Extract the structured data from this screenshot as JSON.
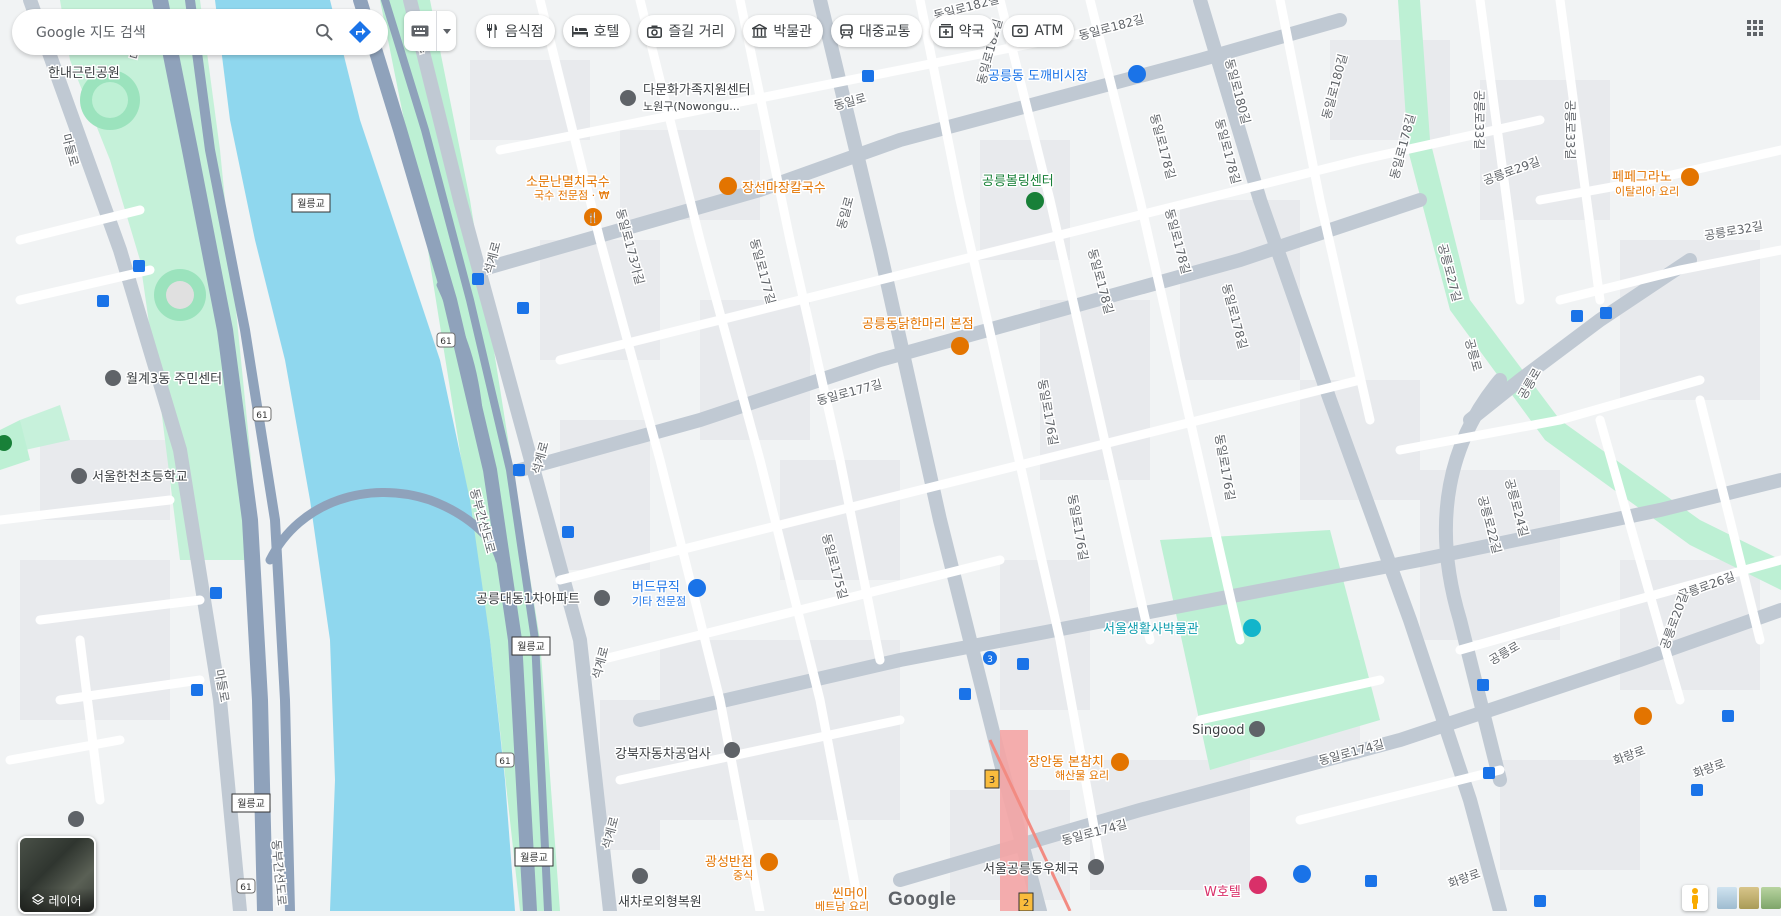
{
  "search": {
    "placeholder": "Google 지도 검색"
  },
  "chips": [
    {
      "label": "음식점",
      "icon": "fork-knife-icon"
    },
    {
      "label": "호텔",
      "icon": "bed-icon"
    },
    {
      "label": "즐길 거리",
      "icon": "camera-icon"
    },
    {
      "label": "박물관",
      "icon": "museum-icon"
    },
    {
      "label": "대중교통",
      "icon": "transit-icon"
    },
    {
      "label": "약국",
      "icon": "pharmacy-icon"
    },
    {
      "label": "ATM",
      "icon": "atm-icon"
    }
  ],
  "layers": {
    "label": "레이어"
  },
  "colors": {
    "water": "#8fd7ee",
    "park": "#bdf0d4",
    "highway": "#8fa2bb",
    "road": "#ffffff",
    "major": "#c0c9d3",
    "food": "#e37400",
    "transit": "#1a73e8"
  },
  "places": {
    "hannae_park": "한내근린공원",
    "multicultural": "다문화가족지원센터",
    "multicultural_sub": "노원구(Nowongu...",
    "somun": "소문난멸치국수",
    "somun_sub": "국수 전문점 · ₩",
    "jangseon": "장선마장칼국수",
    "dokkaebi": "공릉동 도깨비시장",
    "bowling": "공릉볼링센터",
    "dakhanmari": "공릉동닭한마리 본점",
    "pepe": "페페그라노",
    "pepe_sub": "이탈리아 요리",
    "wolgye": "월계3동 주민센터",
    "hancheon": "서울한천초등학교",
    "gongneung1": "공릉대동1차아파트",
    "birdmusic": "버드뮤직",
    "birdmusic_sub": "기타 전문점",
    "museum": "서울생활사박물관",
    "singood": "Singood",
    "janganjang": "장안동 본참치",
    "janganjang_sub": "해산물 요리",
    "gangbuk": "강북자동차공업사",
    "gwangseong": "광성반점",
    "gwangseong_sub": "중식",
    "post": "서울공릉동우체국",
    "whotel": "W호텔",
    "sechaero": "새차로외형복원",
    "ssinmeoi": "씬머이",
    "ssinmeoi_sub": "베트남 요리"
  },
  "roads": {
    "wolleunggyo": "월릉교",
    "dongbu": "동부간선도로",
    "seokgye": "석계로",
    "madeul": "마들로",
    "dongil": "동일로",
    "dongil182": "동일로182길",
    "dongil180": "동일로180길",
    "dongil178": "동일로178길",
    "dongil177": "동일로177길",
    "dongil176": "동일로176길",
    "dongil175": "동일로175길",
    "dongil174": "동일로174길",
    "dongil173": "동일로173가길",
    "gongneung": "공릉로",
    "gongneung27": "공릉로27길",
    "gongneung29": "공릉로29길",
    "gongneung32": "공릉로32길",
    "gongneung33": "공릉로33길",
    "gongneung24": "공릉로24길",
    "gongneung22": "공릉로22길",
    "gongneung26": "공릉로26길",
    "gongneung20": "공릉로20길",
    "hwarang": "화랑로",
    "route61": "61",
    "line3": "3",
    "line2": "2"
  },
  "google": "Google"
}
